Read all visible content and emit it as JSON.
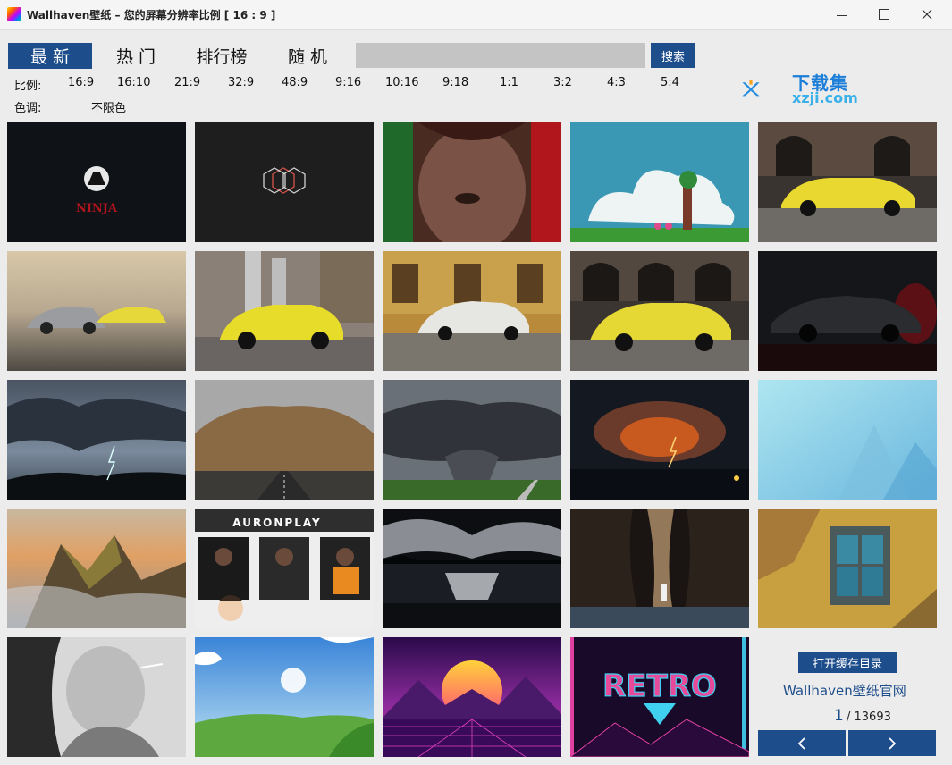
{
  "window": {
    "title": "Wallhaven壁纸  –  您的屏幕分辨率比例 [ 16 : 9 ]"
  },
  "tabs": [
    {
      "label": "最 新"
    },
    {
      "label": "热 门"
    },
    {
      "label": "排行榜"
    },
    {
      "label": "随 机"
    }
  ],
  "search": {
    "value": "",
    "placeholder": "",
    "button_label": "搜索"
  },
  "ratio_row": {
    "label": "比例:",
    "options": [
      "16:9",
      "16:10",
      "21:9",
      "32:9",
      "48:9",
      "9:16",
      "10:16",
      "9:18",
      "1:1",
      "3:2",
      "4:3",
      "5:4"
    ]
  },
  "color_row": {
    "label": "色调:",
    "value": "不限色"
  },
  "watermark": {
    "cn": "下载集",
    "en": "xzji.com"
  },
  "thumbnails": [
    {
      "subject": "ninja-moon"
    },
    {
      "subject": "hexagon-logo"
    },
    {
      "subject": "face-closeup"
    },
    {
      "subject": "cloud-tree-scooter"
    },
    {
      "subject": "yellow-mustang-building"
    },
    {
      "subject": "two-mustangs-sunset"
    },
    {
      "subject": "yellow-mustang-industrial"
    },
    {
      "subject": "white-mustang-brick"
    },
    {
      "subject": "yellow-mustang-arches"
    },
    {
      "subject": "black-ford-gt-red"
    },
    {
      "subject": "storm-clouds-lightning"
    },
    {
      "subject": "dust-storm-road"
    },
    {
      "subject": "supercell-storm-field"
    },
    {
      "subject": "lightning-sunset-sea"
    },
    {
      "subject": "blue-mist-mountains"
    },
    {
      "subject": "mountain-sunset-clouds"
    },
    {
      "subject": "auronplay-frames"
    },
    {
      "subject": "night-lake-moonlight"
    },
    {
      "subject": "canyon-light-figure"
    },
    {
      "subject": "old-window-wall"
    },
    {
      "subject": "woman-smoking-bw"
    },
    {
      "subject": "anime-sky-meadow"
    },
    {
      "subject": "synthwave-sun"
    },
    {
      "subject": "retro-neon"
    }
  ],
  "thumb_text": {
    "ninja": "NINJA",
    "auronplay": "AURONPLAY",
    "retro": "RETRO"
  },
  "footer": {
    "cache_button": "打开缓存目录",
    "site_link": "Wallhaven壁纸官网",
    "current_page": "1",
    "total_pages": "/ 13693"
  },
  "colors": {
    "accent": "#1e4d8c",
    "background": "#ececec",
    "search_bg": "#c4c4c4"
  }
}
